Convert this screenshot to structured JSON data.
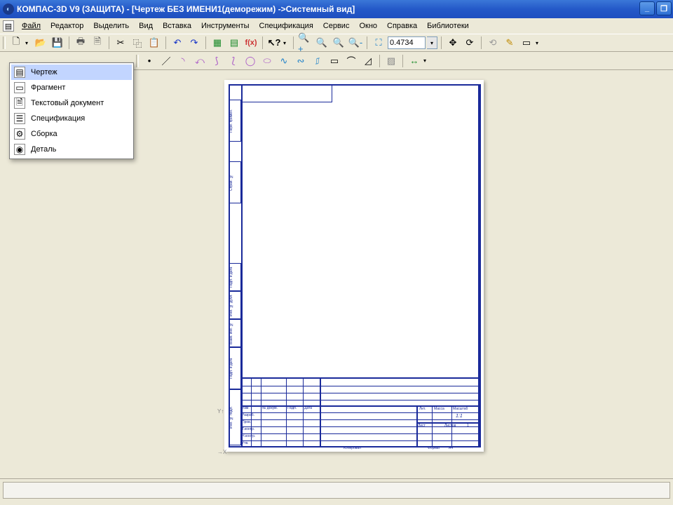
{
  "window": {
    "title": "КОМПАС-3D V9 (ЗАЩИТА) - [Чертеж БЕЗ ИМЕНИ1(деморежим) ->Системный вид]"
  },
  "menubar": {
    "items": [
      "Файл",
      "Редактор",
      "Выделить",
      "Вид",
      "Вставка",
      "Инструменты",
      "Спецификация",
      "Сервис",
      "Окно",
      "Справка",
      "Библиотеки"
    ]
  },
  "toolbar": {
    "zoom_value": "0.4734"
  },
  "dropdown": {
    "items": [
      {
        "label": "Чертеж"
      },
      {
        "label": "Фрагмент"
      },
      {
        "label": "Текстовый документ"
      },
      {
        "label": "Спецификация"
      },
      {
        "label": "Сборка"
      },
      {
        "label": "Деталь"
      }
    ]
  },
  "titleblock": {
    "row_labels": [
      "Изм.",
      "Разраб.",
      "Пров.",
      "Т.контр.",
      "Н.контр.",
      "Утв."
    ],
    "col_labels": [
      "№ докум.",
      "Подп.",
      "Дата"
    ],
    "right": {
      "lit": "Лит.",
      "massa": "Масса",
      "mashtab": "Масштаб",
      "list": "Лист",
      "listov": "Листов",
      "listov_val": "1",
      "ratio": "1:1"
    },
    "bottom": {
      "kopiroval": "Копировал",
      "format": "Формат",
      "a4": "A4"
    },
    "side_labels": [
      "Перв. примен.",
      "Справ. №",
      "Подп. и дата",
      "Инв. № дубл.",
      "Взам. инв. №",
      "Подп. и дата",
      "Инв. № подл."
    ]
  }
}
